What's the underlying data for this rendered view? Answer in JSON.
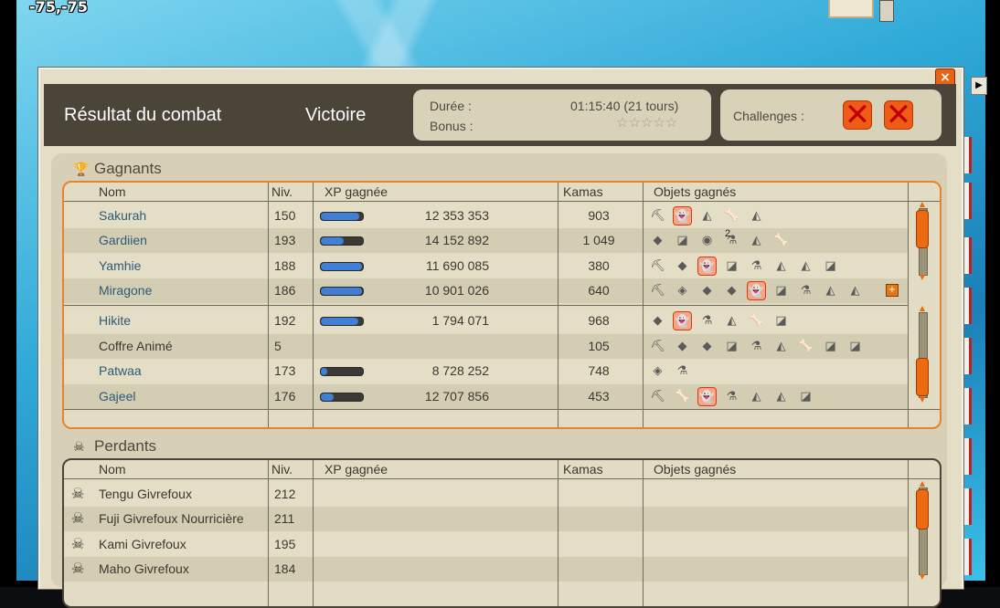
{
  "coords": "-75,-75",
  "window": {
    "title": "Résultat du combat",
    "result": "Victoire",
    "duration_label": "Durée :",
    "duration_value": "01:15:40 (21 tours)",
    "bonus_label": "Bonus :",
    "bonus_stars": "☆☆☆☆☆",
    "challenges_label": "Challenges :",
    "close_glyph": "×"
  },
  "columns": {
    "name": "Nom",
    "level": "Niv.",
    "xp": "XP gagnée",
    "kamas": "Kamas",
    "items": "Objets gagnés"
  },
  "winners": {
    "title": "Gagnants",
    "rows": [
      {
        "name": "Sakurah",
        "level": "150",
        "xp": "12 353 353",
        "xp_fill": 0.92,
        "kamas": "903",
        "link": true,
        "items": [
          "⛏",
          "👻",
          "◭",
          "🦴",
          "◭"
        ],
        "hl": [
          1
        ]
      },
      {
        "name": "Gardiien",
        "level": "193",
        "xp": "14 152 892",
        "xp_fill": 0.55,
        "kamas": "1 049",
        "link": true,
        "items": [
          "◆",
          "◪",
          "◉",
          "⚗",
          "◭",
          "🦴"
        ],
        "hl": []
      },
      {
        "name": "Yamhie",
        "level": "188",
        "xp": "11 690 085",
        "xp_fill": 0.97,
        "kamas": "380",
        "link": true,
        "items": [
          "⛏",
          "◆",
          "👻",
          "◪",
          "⚗",
          "◭",
          "◭",
          "◪"
        ],
        "hl": [
          2
        ]
      },
      {
        "name": "Miragone",
        "level": "186",
        "xp": "10 901 026",
        "xp_fill": 0.97,
        "kamas": "640",
        "link": true,
        "items": [
          "⛏",
          "◈",
          "◆",
          "◆",
          "👻",
          "◪",
          "⚗",
          "◭",
          "◭"
        ],
        "hl": [
          4
        ]
      },
      {
        "name": "Hikite",
        "level": "192",
        "xp": "1 794 071",
        "xp_fill": 0.9,
        "kamas": "968",
        "link": true,
        "items": [
          "◆",
          "👻",
          "⚗",
          "◭",
          "🦴",
          "◪"
        ],
        "hl": [
          1
        ]
      },
      {
        "name": "Coffre Animé",
        "level": "5",
        "xp": "",
        "xp_fill": null,
        "kamas": "105",
        "link": false,
        "items": [
          "⛏",
          "◆",
          "◆",
          "◪",
          "⚗",
          "◭",
          "🦴",
          "◪",
          "◪"
        ],
        "hl": []
      },
      {
        "name": "Patwaa",
        "level": "173",
        "xp": "8 728 252",
        "xp_fill": 0.15,
        "kamas": "748",
        "link": true,
        "items": [
          "◈",
          "⚗"
        ],
        "hl": []
      },
      {
        "name": "Gajeel",
        "level": "176",
        "xp": "12 707 856",
        "xp_fill": 0.3,
        "kamas": "453",
        "link": true,
        "items": [
          "⛏",
          "🦴",
          "👻",
          "⚗",
          "◭",
          "◭",
          "◪"
        ],
        "hl": [
          2
        ]
      }
    ],
    "badge_2": "2",
    "plus_glyph": "+"
  },
  "losers": {
    "title": "Perdants",
    "rows": [
      {
        "name": "Tengu Givrefoux",
        "level": "212"
      },
      {
        "name": "Fuji Givrefoux Nourricière",
        "level": "211"
      },
      {
        "name": "Kami Givrefoux",
        "level": "195"
      },
      {
        "name": "Maho Givrefoux",
        "level": "184"
      }
    ]
  },
  "colors": {
    "accent": "#e8832a",
    "header_bg": "#4b4539",
    "link": "#2e5a78",
    "xp_fill": "#3f7fd6"
  }
}
